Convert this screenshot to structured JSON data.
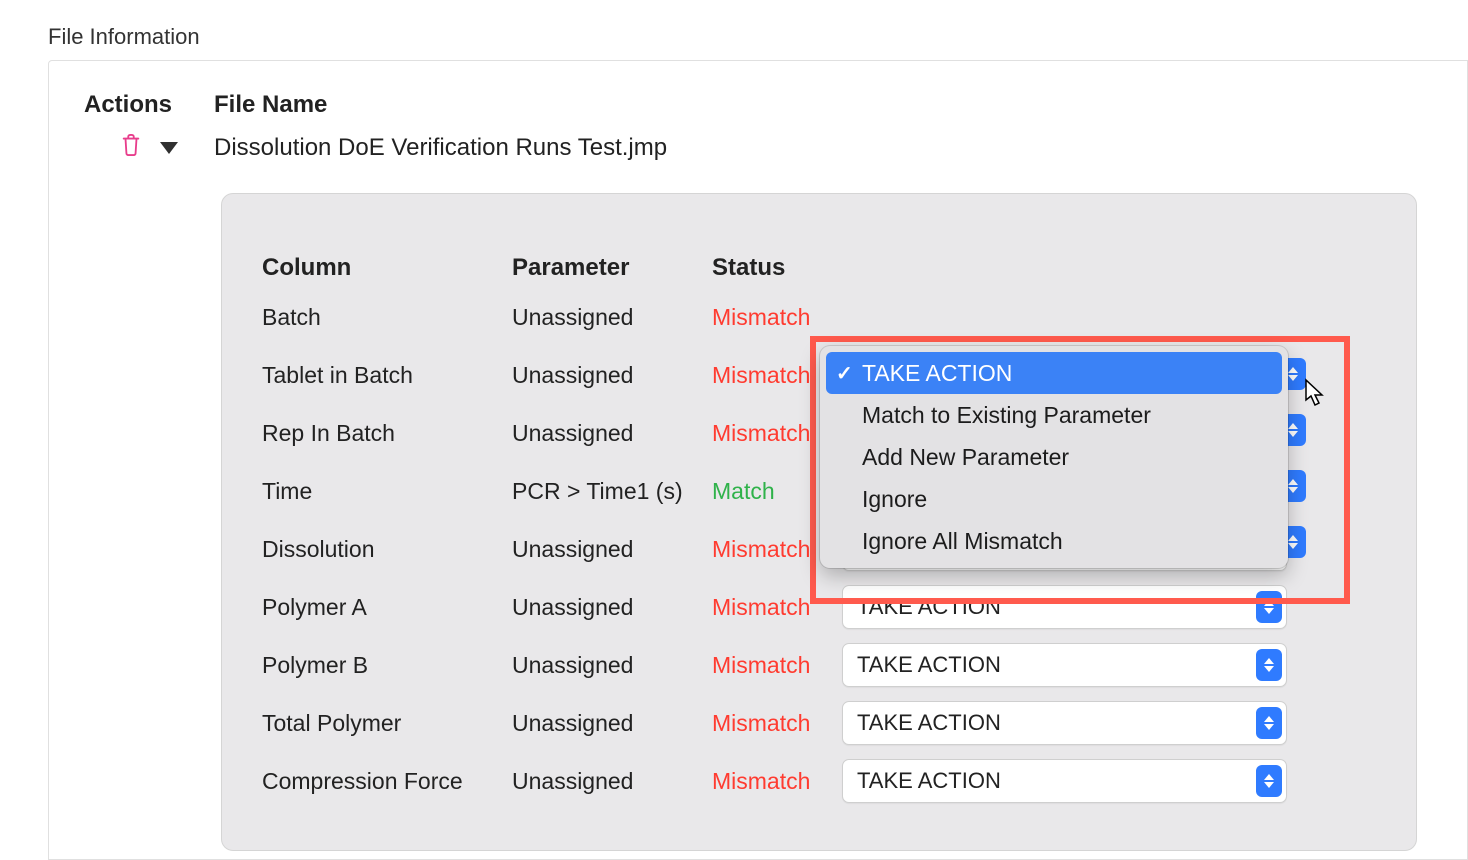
{
  "section_title": "File Information",
  "headers": {
    "actions": "Actions",
    "file_name": "File Name"
  },
  "file": {
    "name": "Dissolution DoE Verification Runs Test.jmp"
  },
  "table": {
    "headers": {
      "column": "Column",
      "parameter": "Parameter",
      "status": "Status"
    },
    "dropdown_label": "TAKE ACTION",
    "rows": [
      {
        "column": "Batch",
        "parameter": "Unassigned",
        "status": "Mismatch",
        "status_kind": "mismatch"
      },
      {
        "column": "Tablet in Batch",
        "parameter": "Unassigned",
        "status": "Mismatch",
        "status_kind": "mismatch"
      },
      {
        "column": "Rep In Batch",
        "parameter": "Unassigned",
        "status": "Mismatch",
        "status_kind": "mismatch"
      },
      {
        "column": "Time",
        "parameter": "PCR  > Time1 (s)",
        "status": "Match",
        "status_kind": "match"
      },
      {
        "column": "Dissolution",
        "parameter": "Unassigned",
        "status": "Mismatch",
        "status_kind": "mismatch"
      },
      {
        "column": "Polymer A",
        "parameter": "Unassigned",
        "status": "Mismatch",
        "status_kind": "mismatch"
      },
      {
        "column": "Polymer B",
        "parameter": "Unassigned",
        "status": "Mismatch",
        "status_kind": "mismatch"
      },
      {
        "column": "Total Polymer",
        "parameter": "Unassigned",
        "status": "Mismatch",
        "status_kind": "mismatch"
      },
      {
        "column": "Compression Force",
        "parameter": "Unassigned",
        "status": "Mismatch",
        "status_kind": "mismatch"
      }
    ]
  },
  "popup": {
    "items": [
      {
        "label": "TAKE ACTION",
        "selected": true
      },
      {
        "label": "Match to Existing Parameter",
        "selected": false
      },
      {
        "label": "Add New Parameter",
        "selected": false
      },
      {
        "label": "Ignore",
        "selected": false
      },
      {
        "label": "Ignore All Mismatch",
        "selected": false
      }
    ]
  }
}
